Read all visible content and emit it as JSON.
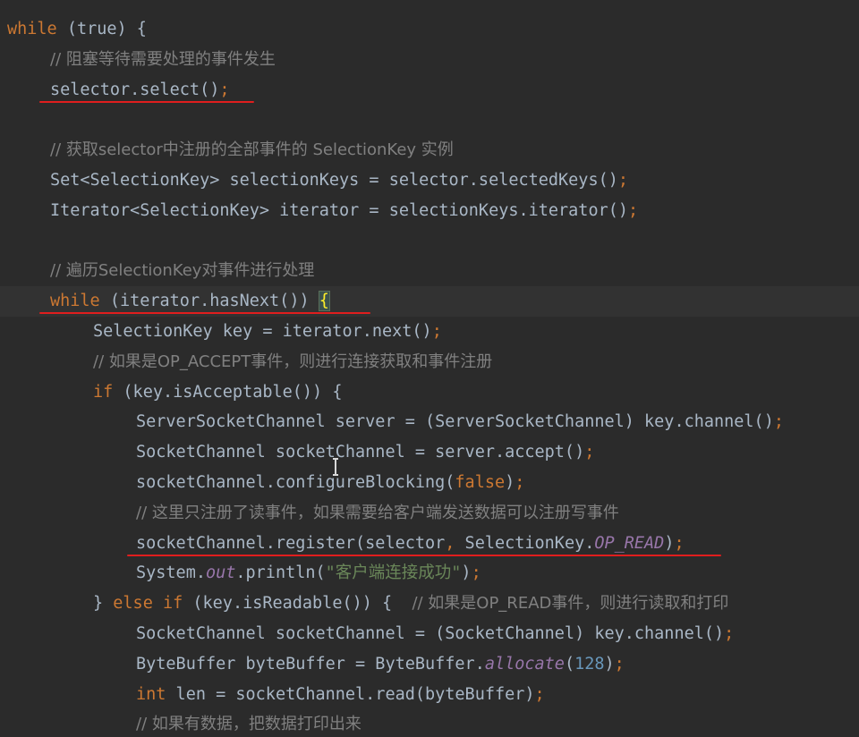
{
  "editor": {
    "lines": [
      {
        "indent": 0,
        "tokens": [
          {
            "k": "kw",
            "t": "while"
          },
          {
            "k": "plain",
            "t": " (true) {"
          }
        ]
      },
      {
        "indent": 1,
        "tokens": [
          {
            "k": "com",
            "t": "// 阻塞等待需要处理的事件发生"
          }
        ]
      },
      {
        "indent": 1,
        "tokens": [
          {
            "k": "plain",
            "t": "selector.select()"
          },
          {
            "k": "punc",
            "t": ";"
          }
        ]
      },
      {
        "indent": 0,
        "tokens": []
      },
      {
        "indent": 1,
        "tokens": [
          {
            "k": "com",
            "t": "// 获取selector中注册的全部事件的 SelectionKey 实例"
          }
        ]
      },
      {
        "indent": 1,
        "tokens": [
          {
            "k": "plain",
            "t": "Set<SelectionKey> selectionKeys = selector.selectedKeys()"
          },
          {
            "k": "punc",
            "t": ";"
          }
        ]
      },
      {
        "indent": 1,
        "tokens": [
          {
            "k": "plain",
            "t": "Iterator<SelectionKey> iterator = selectionKeys.iterator()"
          },
          {
            "k": "punc",
            "t": ";"
          }
        ]
      },
      {
        "indent": 0,
        "tokens": []
      },
      {
        "indent": 1,
        "tokens": [
          {
            "k": "com",
            "t": "// 遍历SelectionKey对事件进行处理"
          }
        ]
      },
      {
        "indent": 1,
        "current": true,
        "tokens": [
          {
            "k": "kw",
            "t": "while"
          },
          {
            "k": "plain",
            "t": " (iterator.hasNext()) "
          },
          {
            "k": "brace",
            "t": "{"
          }
        ]
      },
      {
        "indent": 2,
        "tokens": [
          {
            "k": "plain",
            "t": "SelectionKey key = iterator.next()"
          },
          {
            "k": "punc",
            "t": ";"
          }
        ]
      },
      {
        "indent": 2,
        "tokens": [
          {
            "k": "com",
            "t": "// 如果是OP_ACCEPT事件，则进行连接获取和事件注册"
          }
        ]
      },
      {
        "indent": 2,
        "tokens": [
          {
            "k": "kw",
            "t": "if"
          },
          {
            "k": "plain",
            "t": " (key.isAcceptable()) {"
          }
        ]
      },
      {
        "indent": 3,
        "tokens": [
          {
            "k": "plain",
            "t": "ServerSocketChannel server = (ServerSocketChannel) key.channel()"
          },
          {
            "k": "punc",
            "t": ";"
          }
        ]
      },
      {
        "indent": 3,
        "tokens": [
          {
            "k": "plain",
            "t": "SocketChannel socketChannel = server.accept()"
          },
          {
            "k": "punc",
            "t": ";"
          }
        ]
      },
      {
        "indent": 3,
        "tokens": [
          {
            "k": "plain",
            "t": "socketChannel.configureBlocking("
          },
          {
            "k": "kw",
            "t": "false"
          },
          {
            "k": "plain",
            "t": ")"
          },
          {
            "k": "punc",
            "t": ";"
          }
        ]
      },
      {
        "indent": 3,
        "tokens": [
          {
            "k": "com",
            "t": "// 这里只注册了读事件，如果需要给客户端发送数据可以注册写事件"
          }
        ]
      },
      {
        "indent": 3,
        "tokens": [
          {
            "k": "plain",
            "t": "socketChannel.register(selector"
          },
          {
            "k": "punc",
            "t": ","
          },
          {
            "k": "plain",
            "t": " SelectionKey."
          },
          {
            "k": "static",
            "t": "OP_READ"
          },
          {
            "k": "plain",
            "t": ")"
          },
          {
            "k": "punc",
            "t": ";"
          }
        ]
      },
      {
        "indent": 3,
        "tokens": [
          {
            "k": "plain",
            "t": "System."
          },
          {
            "k": "static",
            "t": "out"
          },
          {
            "k": "plain",
            "t": ".println("
          },
          {
            "k": "str",
            "t": "\"客户端连接成功\""
          },
          {
            "k": "plain",
            "t": ")"
          },
          {
            "k": "punc",
            "t": ";"
          }
        ]
      },
      {
        "indent": 2,
        "tokens": [
          {
            "k": "plain",
            "t": "} "
          },
          {
            "k": "kw",
            "t": "else if"
          },
          {
            "k": "plain",
            "t": " (key.isReadable()) {  "
          },
          {
            "k": "com",
            "t": "// 如果是OP_READ事件，则进行读取和打印"
          }
        ]
      },
      {
        "indent": 3,
        "tokens": [
          {
            "k": "plain",
            "t": "SocketChannel socketChannel = (SocketChannel) key.channel()"
          },
          {
            "k": "punc",
            "t": ";"
          }
        ]
      },
      {
        "indent": 3,
        "tokens": [
          {
            "k": "plain",
            "t": "ByteBuffer byteBuffer = ByteBuffer."
          },
          {
            "k": "static",
            "t": "allocate"
          },
          {
            "k": "plain",
            "t": "("
          },
          {
            "k": "num",
            "t": "128"
          },
          {
            "k": "plain",
            "t": ")"
          },
          {
            "k": "punc",
            "t": ";"
          }
        ]
      },
      {
        "indent": 3,
        "tokens": [
          {
            "k": "kw",
            "t": "int"
          },
          {
            "k": "plain",
            "t": " len = socketChannel.read(byteBuffer)"
          },
          {
            "k": "punc",
            "t": ";"
          }
        ]
      },
      {
        "indent": 3,
        "tokens": [
          {
            "k": "com",
            "t": "// 如果有数据，把数据打印出来"
          }
        ]
      }
    ],
    "colors": {
      "background": "#2b2b2b",
      "keyword": "#cc7832",
      "text": "#a9b7c6",
      "comment": "#808080",
      "string": "#6a8759",
      "number": "#6897bb",
      "static_field": "#9876aa",
      "annotation_underline": "#e01e1e"
    },
    "annotations": [
      {
        "type": "red-underline",
        "line": 3
      },
      {
        "type": "red-underline",
        "line": 10
      },
      {
        "type": "red-underline",
        "line": 18
      }
    ]
  }
}
